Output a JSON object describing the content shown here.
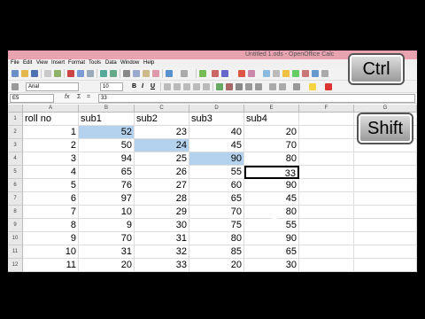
{
  "window": {
    "title": "Untitled 1.ods - OpenOffice Calc"
  },
  "menu": [
    "File",
    "Edit",
    "View",
    "Insert",
    "Format",
    "Tools",
    "Data",
    "Window",
    "Help"
  ],
  "format_toolbar": {
    "font_name": "Arial",
    "font_size": "10",
    "bold": "B",
    "italic": "I",
    "underline": "U"
  },
  "formula_bar": {
    "cell_ref": "E5",
    "fx_label": "fx",
    "sum_label": "Σ",
    "eq_label": "=",
    "content": "33"
  },
  "sheet": {
    "columns": [
      "A",
      "B",
      "C",
      "D",
      "E",
      "F",
      "G"
    ],
    "rows": [
      "1",
      "2",
      "3",
      "4",
      "5",
      "6",
      "7",
      "8",
      "9",
      "10",
      "11",
      "12",
      "13"
    ],
    "header_row": [
      "roll no",
      "sub1",
      "sub2",
      "sub3",
      "sub4"
    ],
    "data": [
      [
        "1",
        "52",
        "23",
        "40",
        "20"
      ],
      [
        "2",
        "50",
        "24",
        "45",
        "70"
      ],
      [
        "3",
        "94",
        "25",
        "90",
        "80"
      ],
      [
        "4",
        "65",
        "26",
        "55",
        "33"
      ],
      [
        "5",
        "76",
        "27",
        "60",
        "90"
      ],
      [
        "6",
        "97",
        "28",
        "65",
        "45"
      ],
      [
        "7",
        "10",
        "29",
        "70",
        "80"
      ],
      [
        "8",
        "9",
        "30",
        "75",
        "55"
      ],
      [
        "9",
        "70",
        "31",
        "80",
        "90"
      ],
      [
        "10",
        "31",
        "32",
        "85",
        "65"
      ],
      [
        "11",
        "20",
        "33",
        "20",
        "30"
      ]
    ]
  },
  "overlay_keys": {
    "ctrl": "Ctrl",
    "shift": "Shift"
  },
  "colors": {
    "titlebar": "#e9a3b0",
    "selection": "#b4d2ee"
  }
}
